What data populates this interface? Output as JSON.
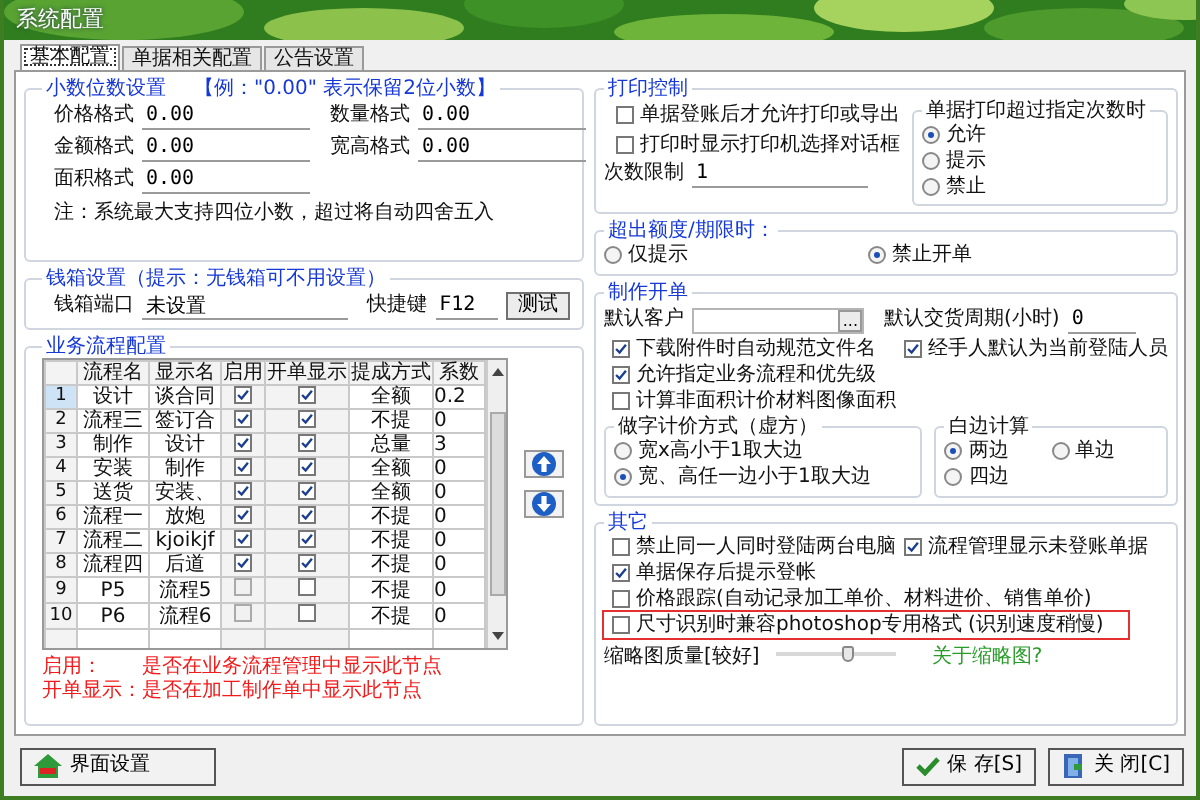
{
  "window": {
    "title": "系统配置"
  },
  "tabs": [
    {
      "label": "基本配置",
      "selected": true
    },
    {
      "label": "单据相关配置",
      "selected": false
    },
    {
      "label": "公告设置",
      "selected": false
    }
  ],
  "decimal_settings": {
    "title": "小数位数设置",
    "hint": "【例：\"0.00\" 表示保留2位小数】",
    "fields": [
      {
        "label": "价格格式",
        "value": "0.00"
      },
      {
        "label": "数量格式",
        "value": "0.00"
      },
      {
        "label": "金额格式",
        "value": "0.00"
      },
      {
        "label": "宽高格式",
        "value": "0.00"
      },
      {
        "label": "面积格式",
        "value": "0.00"
      }
    ],
    "note": "注：系统最大支持四位小数，超过将自动四舍五入"
  },
  "cash_box": {
    "title": "钱箱设置（提示：无钱箱可不用设置）",
    "port": {
      "label": "钱箱端口",
      "value": "未设置"
    },
    "hotkey": {
      "label": "快捷键",
      "value": "F12"
    },
    "test_button": "测试"
  },
  "workflow": {
    "title": "业务流程配置",
    "columns": [
      "流程名",
      "显示名",
      "启用",
      "开单显示",
      "提成方式",
      "系数"
    ],
    "rows": [
      {
        "index": "1",
        "name": "设计",
        "display": "谈合同",
        "enabled": true,
        "show_in_order": true,
        "commission": "全额",
        "coefficient": "0.2",
        "selected": true
      },
      {
        "index": "2",
        "name": "流程三",
        "display": "签订合",
        "enabled": true,
        "show_in_order": true,
        "commission": "不提",
        "coefficient": "0",
        "selected": false
      },
      {
        "index": "3",
        "name": "制作",
        "display": "设计",
        "enabled": true,
        "show_in_order": true,
        "commission": "总量",
        "coefficient": "3",
        "selected": false
      },
      {
        "index": "4",
        "name": "安装",
        "display": "制作",
        "enabled": true,
        "show_in_order": true,
        "commission": "全额",
        "coefficient": "0",
        "selected": false
      },
      {
        "index": "5",
        "name": "送货",
        "display": "安装、",
        "enabled": true,
        "show_in_order": true,
        "commission": "全额",
        "coefficient": "0",
        "selected": false
      },
      {
        "index": "6",
        "name": "流程一",
        "display": "放炮",
        "enabled": true,
        "show_in_order": true,
        "commission": "不提",
        "coefficient": "0",
        "selected": false
      },
      {
        "index": "7",
        "name": "流程二",
        "display": "kjoikjf",
        "enabled": true,
        "show_in_order": true,
        "commission": "不提",
        "coefficient": "0",
        "selected": false
      },
      {
        "index": "8",
        "name": "流程四",
        "display": "后道",
        "enabled": true,
        "show_in_order": true,
        "commission": "不提",
        "coefficient": "0",
        "selected": false
      },
      {
        "index": "9",
        "name": "P5",
        "display": "流程5",
        "enabled": false,
        "show_in_order": false,
        "commission": "不提",
        "coefficient": "0",
        "selected": false
      },
      {
        "index": "10",
        "name": "P6",
        "display": "流程6",
        "enabled": false,
        "show_in_order": false,
        "commission": "不提",
        "coefficient": "0",
        "selected": false
      }
    ],
    "notes": [
      {
        "label": "启用：",
        "text": "是否在业务流程管理中显示此节点"
      },
      {
        "label": "开单显示：",
        "text": "是否在加工制作单中显示此节点"
      }
    ]
  },
  "print_control": {
    "title": "打印控制",
    "checkboxes": [
      {
        "label": "单据登账后才允许打印或导出",
        "checked": false
      },
      {
        "label": "打印时显示打印机选择对话框",
        "checked": false
      }
    ],
    "count_limit": {
      "label": "次数限制",
      "value": "1"
    },
    "over_count": {
      "title": "单据打印超过指定次数时",
      "options": [
        {
          "label": "允许",
          "selected": true
        },
        {
          "label": "提示",
          "selected": false
        },
        {
          "label": "禁止",
          "selected": false
        }
      ]
    }
  },
  "over_quota": {
    "title": "超出额度/期限时：",
    "options": [
      {
        "label": "仅提示",
        "selected": false
      },
      {
        "label": "禁止开单",
        "selected": true
      }
    ]
  },
  "order": {
    "title": "制作开单",
    "customer": {
      "label": "默认客户"
    },
    "browse_button": "...",
    "delivery": {
      "label": "默认交货周期(小时)",
      "value": "0"
    },
    "checkbox_rows": [
      [
        {
          "label": "下载附件时自动规范文件名",
          "checked": true
        },
        {
          "label": "经手人默认为当前登陆人员",
          "checked": true
        }
      ],
      [
        {
          "label": "允许指定业务流程和优先级",
          "checked": true
        }
      ],
      [
        {
          "label": "计算非面积计价材料图像面积",
          "checked": false
        }
      ]
    ],
    "pricing": {
      "title": "做字计价方式（虚方）",
      "options": [
        {
          "label": "宽x高小于1取大边",
          "selected": false
        },
        {
          "label": "宽、高任一边小于1取大边",
          "selected": true
        }
      ]
    },
    "margin": {
      "title": "白边计算",
      "options": [
        {
          "label": "两边",
          "selected": true
        },
        {
          "label": "单边",
          "selected": false
        },
        {
          "label": "四边",
          "selected": false
        }
      ]
    }
  },
  "other": {
    "title": "其它",
    "checkbox_rows": [
      [
        {
          "label": "禁止同一人同时登陆两台电脑",
          "checked": false,
          "highlighted": false
        },
        {
          "label": "流程管理显示未登账单据",
          "checked": true,
          "highlighted": false
        }
      ],
      [
        {
          "label": "单据保存后提示登帐",
          "checked": true,
          "highlighted": false
        }
      ],
      [
        {
          "label": "价格跟踪(自动记录加工单价、材料进价、销售单价)",
          "checked": false,
          "highlighted": false
        }
      ],
      [
        {
          "label": "尺寸识别时兼容photoshop专用格式 (识别速度稍慢)",
          "checked": false,
          "highlighted": true
        }
      ]
    ],
    "thumbnail": {
      "label": "缩略图质量[较好]",
      "level": 0.6
    },
    "link": "关于缩略图?"
  },
  "footer": {
    "ui_button": "界面设置",
    "save_button": "保 存[S]",
    "close_button": "关 闭[C]"
  }
}
